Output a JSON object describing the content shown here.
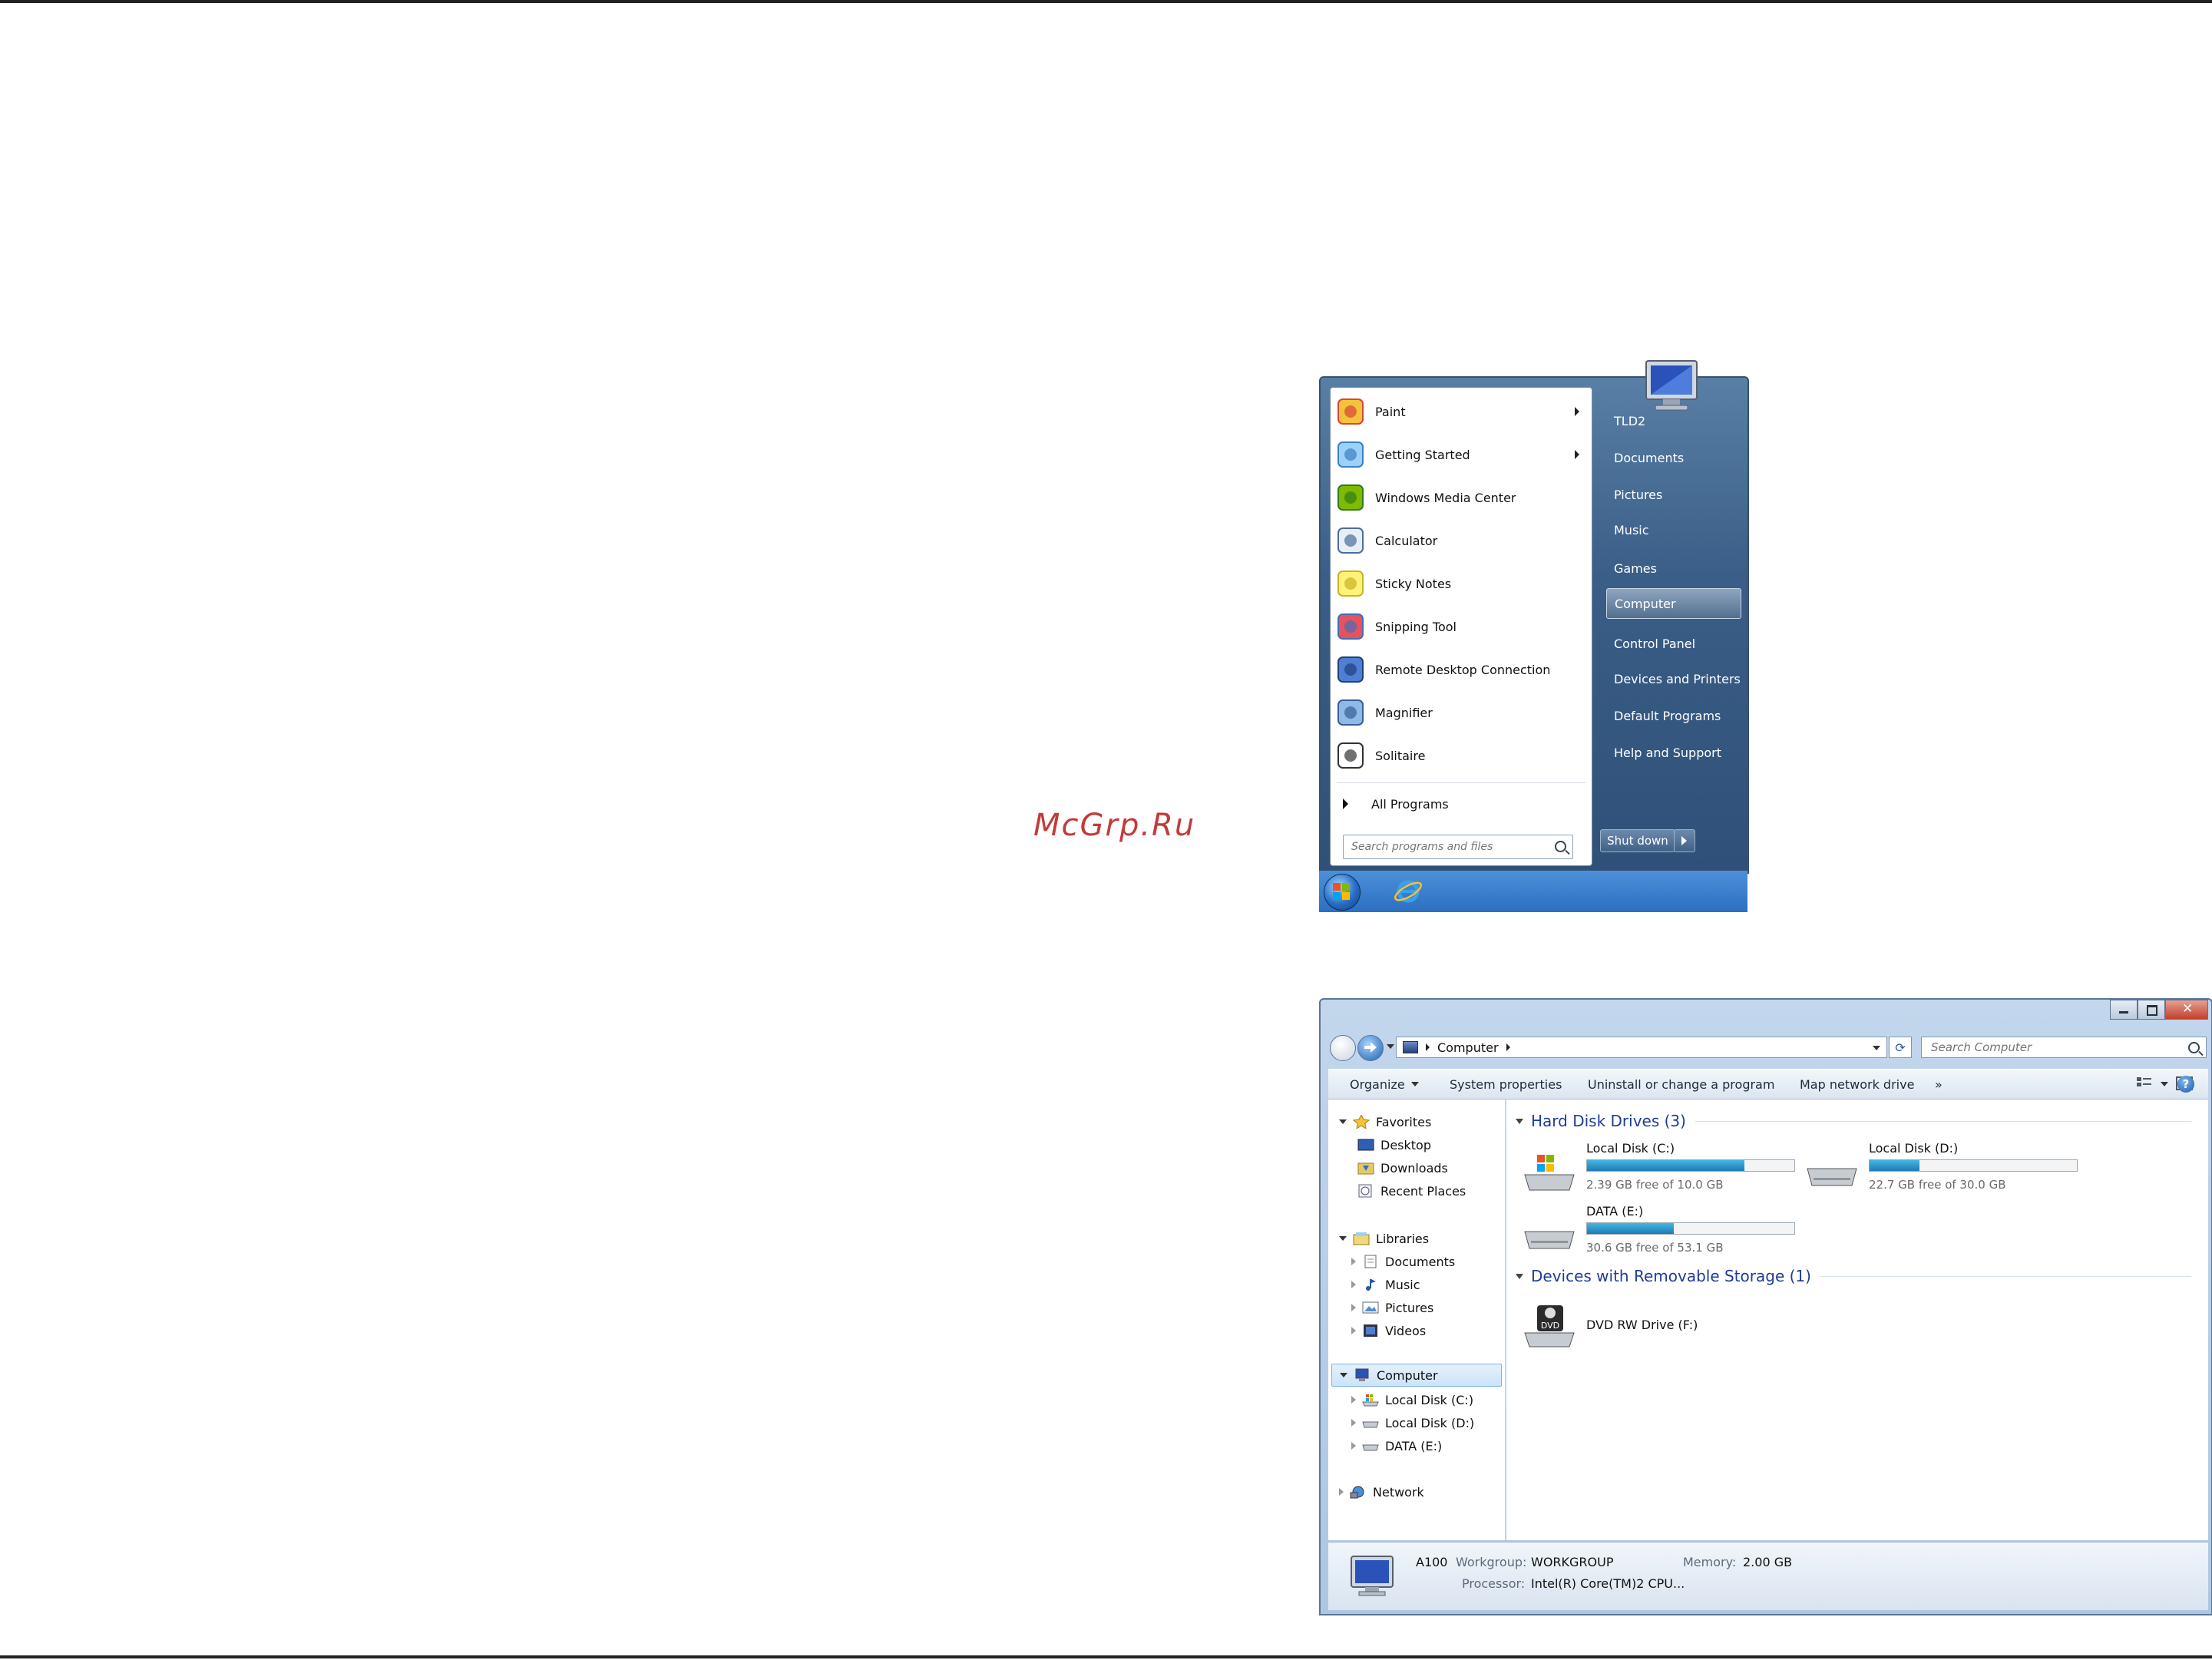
{
  "watermark": "McGrp.Ru",
  "start_menu": {
    "pinned": [
      {
        "label": "Paint",
        "icon": "paint-icon",
        "has_submenu": true
      },
      {
        "label": "Getting Started",
        "icon": "getting-started-icon",
        "has_submenu": true
      },
      {
        "label": "Windows Media Center",
        "icon": "media-center-icon",
        "has_submenu": false
      },
      {
        "label": "Calculator",
        "icon": "calculator-icon",
        "has_submenu": false
      },
      {
        "label": "Sticky Notes",
        "icon": "sticky-notes-icon",
        "has_submenu": false
      },
      {
        "label": "Snipping Tool",
        "icon": "snipping-tool-icon",
        "has_submenu": false
      },
      {
        "label": "Remote Desktop Connection",
        "icon": "remote-desktop-icon",
        "has_submenu": false
      },
      {
        "label": "Magnifier",
        "icon": "magnifier-icon",
        "has_submenu": false
      },
      {
        "label": "Solitaire",
        "icon": "solitaire-icon",
        "has_submenu": false
      }
    ],
    "all_programs": "All Programs",
    "search_placeholder": "Search programs and files",
    "right_items": [
      "TLD2",
      "Documents",
      "Pictures",
      "Music",
      "Games",
      "Computer",
      "Control Panel",
      "Devices and Printers",
      "Default Programs",
      "Help and Support"
    ],
    "selected_right_item": "Computer",
    "shutdown": "Shut down"
  },
  "explorer": {
    "address": "Computer",
    "search_placeholder": "Search Computer",
    "toolbar": {
      "organize": "Organize",
      "system_properties": "System properties",
      "uninstall": "Uninstall or change a program",
      "map_drive": "Map network drive",
      "more": "»",
      "help": "?"
    },
    "nav": {
      "favorites": "Favorites",
      "desktop": "Desktop",
      "downloads": "Downloads",
      "recent": "Recent Places",
      "libraries": "Libraries",
      "documents": "Documents",
      "music": "Music",
      "pictures": "Pictures",
      "videos": "Videos",
      "computer": "Computer",
      "disk_c": "Local Disk (C:)",
      "disk_d": "Local Disk (D:)",
      "data_e": "DATA (E:)",
      "network": "Network"
    },
    "groups": {
      "hdd": "Hard Disk Drives (3)",
      "removable": "Devices with Removable Storage (1)"
    },
    "drives": [
      {
        "name": "Local Disk (C:)",
        "free": "2.39 GB free of 10.0 GB",
        "used_fraction": 0.76
      },
      {
        "name": "Local Disk (D:)",
        "free": "22.7 GB free of 30.0 GB",
        "used_fraction": 0.24
      },
      {
        "name": "DATA (E:)",
        "free": "30.6 GB free of 53.1 GB",
        "used_fraction": 0.42
      }
    ],
    "dvd": {
      "name": "DVD RW Drive (F:)",
      "badge": "DVD"
    },
    "details": {
      "computer_name": "A100",
      "workgroup_label": "Workgroup:",
      "workgroup": "WORKGROUP",
      "memory_label": "Memory:",
      "memory": "2.00 GB",
      "processor_label": "Processor:",
      "processor": "Intel(R) Core(TM)2 CPU..."
    }
  }
}
